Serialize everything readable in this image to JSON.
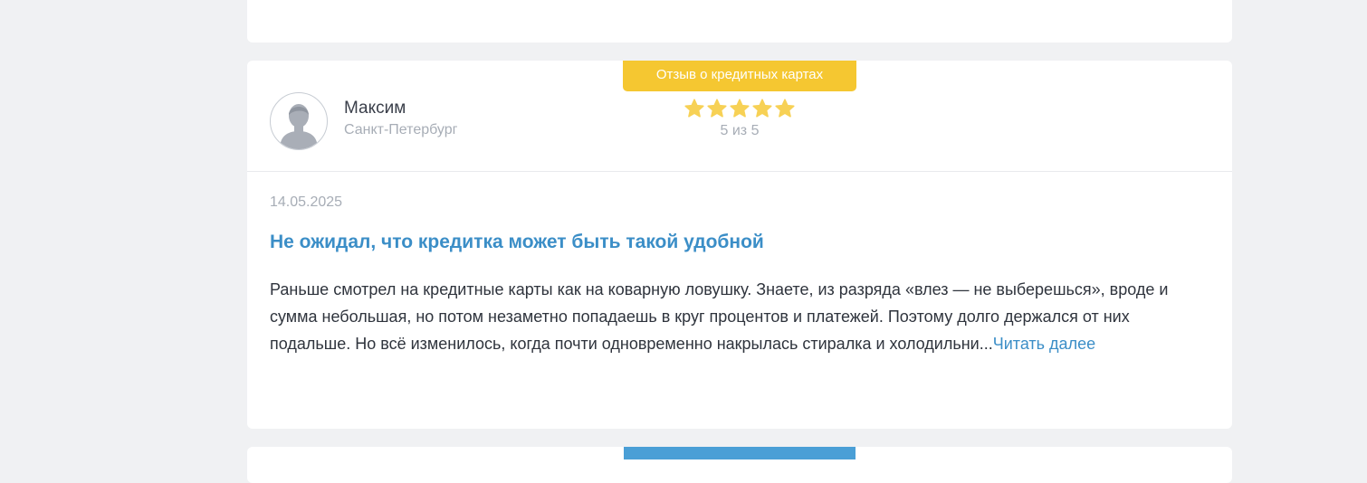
{
  "review": {
    "category_badge": "Отзыв о кредитных картах",
    "author": {
      "name": "Максим",
      "city": "Санкт-Петербург"
    },
    "rating": {
      "stars": 5,
      "max": 5,
      "label": "5 из 5"
    },
    "date": "14.05.2025",
    "title": "Не ожидал, что кредитка может быть такой удобной",
    "excerpt": "Раньше смотрел на кредитные карты как на коварную ловушку. Знаете, из разряда «влез — не выберешься», вроде и сумма небольшая, но потом незаметно попадаешь в круг процентов и платежей. Поэтому долго держался от них подальше. Но всё изменилось, когда почти одновременно накрылась стиралка и холодильни...",
    "read_more": "Читать далее"
  },
  "colors": {
    "accent_blue": "#3b8ec7",
    "badge_yellow": "#f5c731",
    "star_yellow": "#f7d155",
    "next_badge_blue": "#4a9fd6"
  },
  "icons": {
    "avatar": "user-silhouette-icon",
    "star": "star-icon"
  }
}
